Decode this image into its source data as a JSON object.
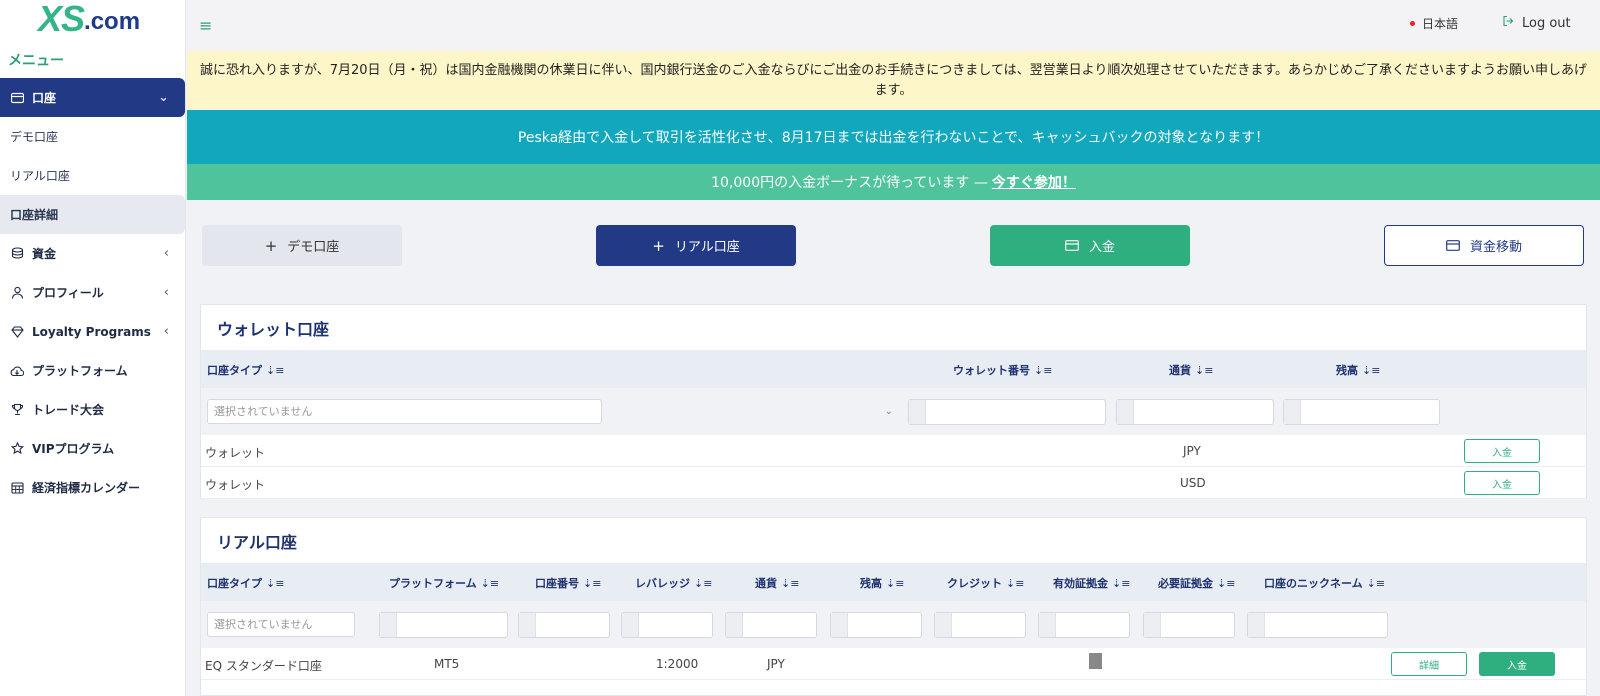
{
  "brand": {
    "logo_main": "XS",
    "logo_suffix": ".com"
  },
  "sidebar": {
    "menu_title": "メニュー",
    "items": [
      {
        "label": "口座",
        "icon": "wallet-icon",
        "active": true
      },
      {
        "label": "デモ口座"
      },
      {
        "label": "リアル口座"
      },
      {
        "label": "口座詳細"
      },
      {
        "label": "資金",
        "icon": "coins-icon"
      },
      {
        "label": "プロフィール",
        "icon": "user-icon"
      },
      {
        "label": "Loyalty Programs",
        "icon": "diamond-icon"
      },
      {
        "label": "プラットフォーム",
        "icon": "cloud-download-icon"
      },
      {
        "label": "トレード大会",
        "icon": "trophy-icon"
      },
      {
        "label": "VIPプログラム",
        "icon": "star-icon"
      },
      {
        "label": "経済指標カレンダー",
        "icon": "calendar-icon"
      }
    ]
  },
  "topbar": {
    "language": "日本語",
    "logout": "Log out"
  },
  "banners": {
    "notice": "誠に恐れ入りますが、7月20日（月・祝）は国内金融機関の休業日に伴い、国内銀行送金のご入金ならびにご出金のお手続きにつきましては、翌営業日より順次処理させていただきます。あらかじめご了承くださいますようお願い申しあげます。",
    "peska": "Peska経由で入金して取引を活性化させ、8月17日までは出金を行わないことで、キャッシュバックの対象となります！",
    "bonus_text": "10,000円の入金ボーナスが待っています —",
    "bonus_link": "今すぐ参加！"
  },
  "actions": {
    "demo": "デモ口座",
    "real": "リアル口座",
    "deposit": "入金",
    "transfer": "資金移動"
  },
  "wallet": {
    "title": "ウォレット口座",
    "headers": [
      "口座タイプ",
      "ウォレット番号",
      "通貨",
      "残高"
    ],
    "filter_placeholder": "選択されていません",
    "rows": [
      {
        "type": "ウォレット",
        "currency": "JPY",
        "action": "入金"
      },
      {
        "type": "ウォレット",
        "currency": "USD",
        "action": "入金"
      }
    ]
  },
  "real": {
    "title": "リアル口座",
    "headers": [
      "口座タイプ",
      "プラットフォーム",
      "口座番号",
      "レバレッジ",
      "通貨",
      "残高",
      "クレジット",
      "有効証拠金",
      "必要証拠金",
      "口座のニックネーム"
    ],
    "filter_placeholder": "選択されていません",
    "rows": [
      {
        "type": "EQ スタンダード口座",
        "platform": "MT5",
        "leverage": "1:2000",
        "currency": "JPY",
        "detail": "詳細",
        "deposit": "入金"
      }
    ]
  },
  "colors": {
    "navy": "#223a86",
    "green": "#2fae80",
    "teal": "#11a8be",
    "notice_yellow": "#fdf6c9"
  }
}
